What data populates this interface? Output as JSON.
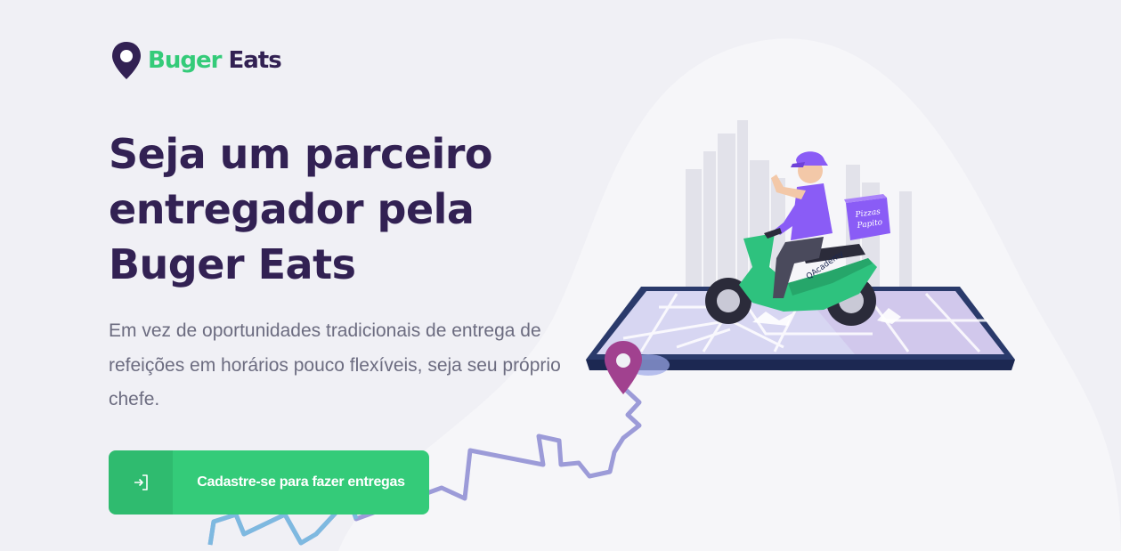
{
  "brand": {
    "part1": "Buger",
    "part2": "Eats"
  },
  "hero": {
    "title_line1": "Seja um parceiro",
    "title_line2": "entregador pela",
    "title_line3": "Buger Eats",
    "description": "Em vez de oportunidades tradicionais de entrega de refeições em horários pouco flexíveis, seja seu próprio chefe."
  },
  "cta": {
    "label": "Cadastre-se para fazer entregas",
    "icon": "sign-in-icon"
  },
  "illustration": {
    "box_text_line1": "Pizzas",
    "box_text_line2": "Papito",
    "scooter_text": "QAcademy"
  },
  "colors": {
    "primary": "#34CB79",
    "title": "#322153",
    "text": "#6C6C80",
    "background": "#F0F0F5",
    "rider_shirt": "#8A5CF6"
  }
}
